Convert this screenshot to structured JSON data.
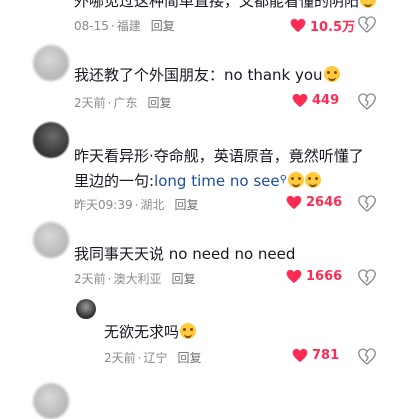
{
  "comments": [
    {
      "text": "外哪见过这种简单直接，叉都能看懂的阴阳",
      "date": "08-15",
      "location": "福建",
      "reply_label": "回复",
      "likes": "10.5万"
    },
    {
      "text": "我还教了个外国朋友：no thank you",
      "date": "2天前",
      "location": "广东",
      "reply_label": "回复",
      "likes": "449"
    },
    {
      "text_line1": "昨天看异形·夺命舰，英语原音，竟然听懂了",
      "text_line2_prefix": "里边的一句:",
      "text_link": "long time no see",
      "date": "昨天09:39",
      "location": "湖北",
      "reply_label": "回复",
      "likes": "2646"
    },
    {
      "text": "我同事天天说 no need no need",
      "date": "2天前",
      "location": "澳大利亚",
      "reply_label": "回复",
      "likes": "1666"
    },
    {
      "text": "无欲无求吗",
      "date": "2天前",
      "location": "辽宁",
      "reply_label": "回复",
      "likes": "781"
    }
  ],
  "icons": {
    "like": "heart-icon",
    "dislike": "broken-heart-icon",
    "emoji": "emoji-icon",
    "search": "search-icon"
  },
  "colors": {
    "like": "#fe2c55",
    "meta": "#8a8b91",
    "link": "#1e4e99",
    "text": "#161823"
  }
}
